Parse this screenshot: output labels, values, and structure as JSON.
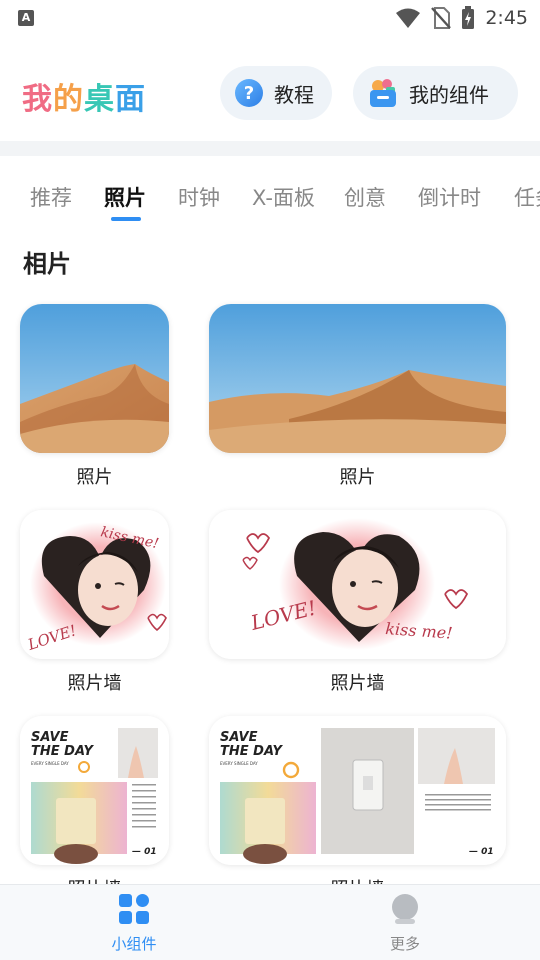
{
  "status_bar": {
    "notification_icon": "A",
    "time": "2:45",
    "icons": [
      "wifi-icon",
      "no-sim-icon",
      "battery-charging-icon"
    ]
  },
  "header": {
    "app_title_chars": [
      "我",
      "的",
      "桌",
      "面"
    ],
    "tutorial_label": "教程",
    "my_widgets_label": "我的组件"
  },
  "tabs": [
    "推荐",
    "照片",
    "时钟",
    "X-面板",
    "创意",
    "倒计时",
    "任务"
  ],
  "active_tab": "照片",
  "section": {
    "title": "相片",
    "cards": [
      {
        "label": "照片",
        "image": "desert-small"
      },
      {
        "label": "照片",
        "image": "desert-medium"
      },
      {
        "label": "照片墙",
        "image": "heart-photo-small"
      },
      {
        "label": "照片墙",
        "image": "heart-photo-medium"
      },
      {
        "label": "照片墙",
        "image": "save-the-day-small"
      },
      {
        "label": "照片墙",
        "image": "save-the-day-medium"
      }
    ],
    "save_the_day_text": "SAVE THE DAY",
    "save_the_day_sub": "EVERY SINGLE DAY",
    "page_number": "— 01",
    "handwriting_kiss": "kiss me!",
    "handwriting_love": "LOVE!"
  },
  "bottom_nav": {
    "widgets_label": "小组件",
    "more_label": "更多"
  },
  "colors": {
    "accent": "#2f8ef3",
    "title_pink": "#f06c84",
    "title_orange": "#f5a04a",
    "title_teal": "#38c7b5",
    "title_blue": "#3aa0e8"
  }
}
